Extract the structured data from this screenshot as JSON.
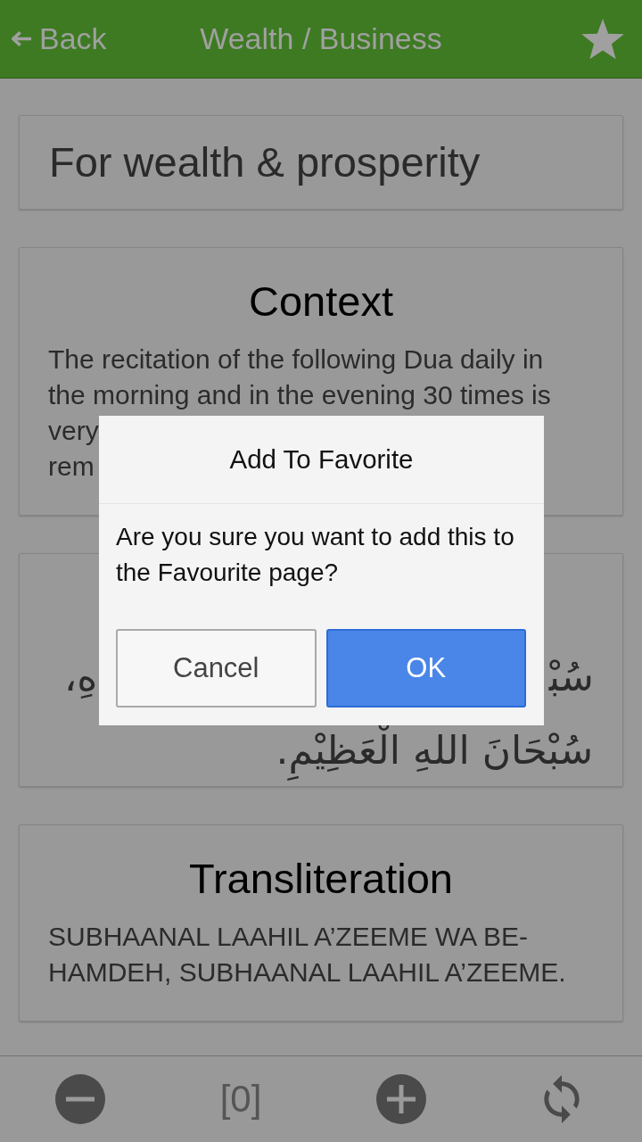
{
  "header": {
    "back_label": "Back",
    "title": "Wealth / Business"
  },
  "cards": [
    {
      "kind": "title",
      "text": "For wealth & prosperity"
    },
    {
      "kind": "latin",
      "heading": "Context",
      "blocks": [
        {
          "kind": "paragraph",
          "text": "The recitation of the following Dua daily in the morning and in the evening 30 times is very"
        },
        {
          "kind": "fragments",
          "parts": [
            "rem"
          ]
        }
      ]
    },
    {
      "kind": "arabic",
      "blocks": [
        {
          "kind": "fragments",
          "parts": [
            "سُبْ‍",
            "هِ،"
          ]
        },
        {
          "kind": "paragraph",
          "text": "سُبْحَانَ اللهِ الْعَظِيْمِ."
        }
      ]
    },
    {
      "kind": "latin",
      "heading": "Transliteration",
      "blocks": [
        {
          "kind": "paragraph",
          "text": "SUBHAANAL LAAHIL A’ZEEME WA BE-HAMDEH, SUBHAANAL LAAHIL A’ZEEME."
        }
      ]
    }
  ],
  "toolbar": {
    "items": [
      {
        "kind": "decrease"
      },
      {
        "kind": "counter",
        "text": "[0]"
      },
      {
        "kind": "increase"
      },
      {
        "kind": "refresh"
      }
    ]
  },
  "dialog": {
    "title": "Add To Favorite",
    "message": "Are you sure you want to add this to the Favourite page?",
    "buttons": [
      {
        "kind": "secondary",
        "label": "Cancel"
      },
      {
        "kind": "primary",
        "label": "OK"
      }
    ]
  }
}
